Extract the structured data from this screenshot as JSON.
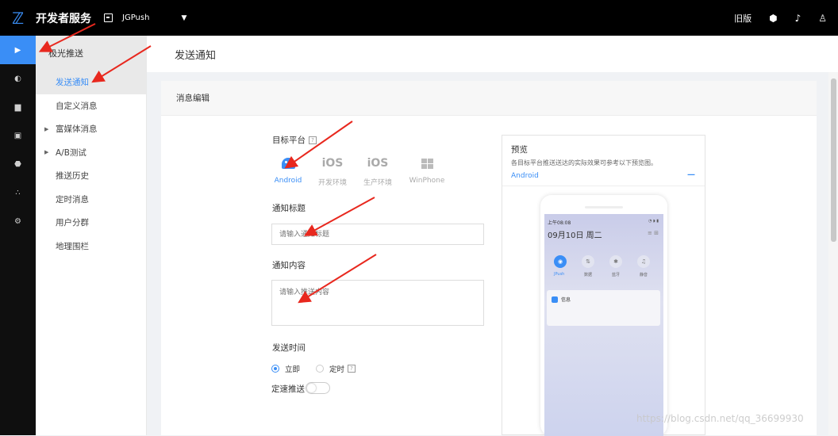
{
  "topbar": {
    "brand": "开发者服务",
    "app_name": "JGPush",
    "old_version": "旧版"
  },
  "subnav": {
    "header": "极光推送",
    "items": [
      {
        "label": "发送通知",
        "active": true,
        "expandable": false
      },
      {
        "label": "自定义消息",
        "active": false,
        "expandable": false
      },
      {
        "label": "富媒体消息",
        "active": false,
        "expandable": true
      },
      {
        "label": "A/B测试",
        "active": false,
        "expandable": true
      },
      {
        "label": "推送历史",
        "active": false,
        "expandable": false
      },
      {
        "label": "定时消息",
        "active": false,
        "expandable": false
      },
      {
        "label": "用户分群",
        "active": false,
        "expandable": false
      },
      {
        "label": "地理围栏",
        "active": false,
        "expandable": false
      }
    ]
  },
  "page": {
    "title": "发送通知",
    "card_title": "消息编辑"
  },
  "form": {
    "platform_label": "目标平台",
    "platforms": [
      {
        "label": "Android",
        "icon": "android-icon",
        "active": true
      },
      {
        "label": "开发环境",
        "icon": "ios-icon",
        "text": "iOS",
        "active": false
      },
      {
        "label": "生产环境",
        "icon": "ios-icon",
        "text": "iOS",
        "active": false
      },
      {
        "label": "WinPhone",
        "icon": "windows-icon",
        "active": false
      }
    ],
    "title_label": "通知标题",
    "title_placeholder": "请输入通知标题",
    "content_label": "通知内容",
    "content_placeholder": "请输入推送内容",
    "time_label": "发送时间",
    "time_now": "立即",
    "time_scheduled": "定时",
    "speed_label": "定速推送",
    "help_glyph": "?"
  },
  "preview": {
    "title": "预览",
    "desc": "各目标平台推送送达的实际效果可参考以下预览图。",
    "platform": "Android",
    "collapse": "—",
    "status_time": "上午08:08",
    "date": "09月10日  周二",
    "quick": [
      "JPush",
      "数据",
      "蓝牙",
      "静音"
    ],
    "notif_label": "信息"
  },
  "watermark": "https://blog.csdn.net/qq_36699930",
  "colors": {
    "accent": "#3a8ef6",
    "arrow": "#e8281e"
  }
}
